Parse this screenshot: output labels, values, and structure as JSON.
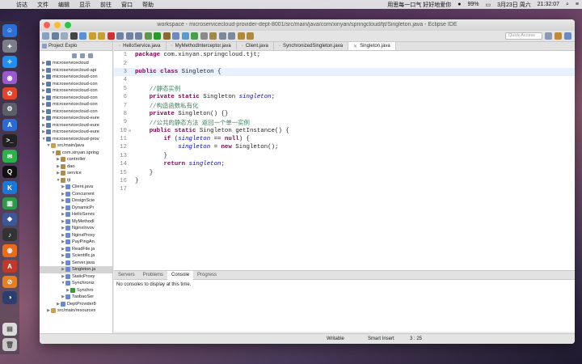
{
  "menubar": {
    "items": [
      "访达",
      "文件",
      "编辑",
      "显示",
      "前往",
      "窗口",
      "帮助"
    ],
    "right": [
      "用思每一口气 好好地爱你",
      "99%",
      "3月23日 周六",
      "21:32:07"
    ]
  },
  "window": {
    "title": "workspace - microservicecloud-provider-dept-8001/src/main/java/com/xinyan/springcloud/tjt/Singleton.java - Eclipse IDE",
    "quick_access": "Quick Access"
  },
  "explorer": {
    "title": "Project Explo",
    "rows": [
      {
        "label": "microservicecloud",
        "indent": 1,
        "open": false
      },
      {
        "label": "microservicecloud-api",
        "indent": 1,
        "open": false
      },
      {
        "label": "microservicecloud-con",
        "indent": 1,
        "open": false
      },
      {
        "label": "microservicecloud-con",
        "indent": 1,
        "open": false
      },
      {
        "label": "microservicecloud-con",
        "indent": 1,
        "open": false
      },
      {
        "label": "microservicecloud-con",
        "indent": 1,
        "open": false
      },
      {
        "label": "microservicecloud-con",
        "indent": 1,
        "open": false
      },
      {
        "label": "microservicecloud-con",
        "indent": 1,
        "open": false
      },
      {
        "label": "microservicecloud-eure",
        "indent": 1,
        "open": false
      },
      {
        "label": "microservicecloud-eure",
        "indent": 1,
        "open": false
      },
      {
        "label": "microservicecloud-eure",
        "indent": 1,
        "open": false
      },
      {
        "label": "microservicecloud-prov",
        "indent": 1,
        "open": true
      },
      {
        "label": "src/main/java",
        "indent": 2,
        "open": true
      },
      {
        "label": "com.xinyan.spring",
        "indent": 3,
        "open": true
      },
      {
        "label": "controller",
        "indent": 4,
        "open": false
      },
      {
        "label": "dao",
        "indent": 4,
        "open": false
      },
      {
        "label": "service",
        "indent": 4,
        "open": false
      },
      {
        "label": "tjt",
        "indent": 4,
        "open": true
      },
      {
        "label": "Client.java",
        "indent": 5,
        "open": false
      },
      {
        "label": "Concurrent",
        "indent": 5,
        "open": false
      },
      {
        "label": "DesignScie",
        "indent": 5,
        "open": false
      },
      {
        "label": "DynamicPr",
        "indent": 5,
        "open": false
      },
      {
        "label": "HelloServic",
        "indent": 5,
        "open": false
      },
      {
        "label": "MyMethodI",
        "indent": 5,
        "open": false
      },
      {
        "label": "NginxInvov",
        "indent": 5,
        "open": false
      },
      {
        "label": "NginxProxy",
        "indent": 5,
        "open": false
      },
      {
        "label": "PayPingAn.",
        "indent": 5,
        "open": false
      },
      {
        "label": "ReadFile.ja",
        "indent": 5,
        "open": false
      },
      {
        "label": "Scientific.ja",
        "indent": 5,
        "open": false
      },
      {
        "label": "Server.java",
        "indent": 5,
        "open": false
      },
      {
        "label": "Singleton.ja",
        "indent": 5,
        "open": false,
        "selected": true
      },
      {
        "label": "StaticProxy",
        "indent": 5,
        "open": false
      },
      {
        "label": "Synchroniz",
        "indent": 5,
        "open": true
      },
      {
        "label": "Synchro",
        "indent": 6,
        "open": false
      },
      {
        "label": "TaobaoSer",
        "indent": 5,
        "open": false
      },
      {
        "label": "DeptProvider8",
        "indent": 4,
        "open": false
      },
      {
        "label": "src/main/resources",
        "indent": 2,
        "open": false
      }
    ]
  },
  "editor": {
    "tabs": [
      {
        "label": "HelloService.java",
        "active": false
      },
      {
        "label": "MyMethodInterceptor.java",
        "active": false
      },
      {
        "label": "Client.java",
        "active": false
      },
      {
        "label": "SynchronizedSingleton.java",
        "active": false
      },
      {
        "label": "Singleton.java",
        "active": true
      }
    ],
    "lines": [
      "package com.xinyan.springcloud.tjt;",
      "",
      "public class Singleton {",
      "",
      "    //静态实例",
      "    private static Singleton singleton;",
      "    //构造函数私有化",
      "    private Singleton() {}",
      "    //公共的静态方法 返回一个单一实例",
      "    public static Singleton getInstance() {",
      "        if (singleton == null) {",
      "            singleton = new Singleton();",
      "        }",
      "        return singleton;",
      "    }",
      "}",
      ""
    ]
  },
  "console": {
    "tabs": [
      "Servers",
      "Problems",
      "Console",
      "Progress"
    ],
    "active": "Console",
    "message": "No consoles to display at this time."
  },
  "status": {
    "writable": "Writable",
    "insert": "Smart Insert",
    "position": "3 : 25"
  },
  "colors": {
    "keyword": "#7f0055",
    "field": "#0000c0",
    "comment": "#3f7f5f",
    "current_line": "#e8f2fe"
  }
}
